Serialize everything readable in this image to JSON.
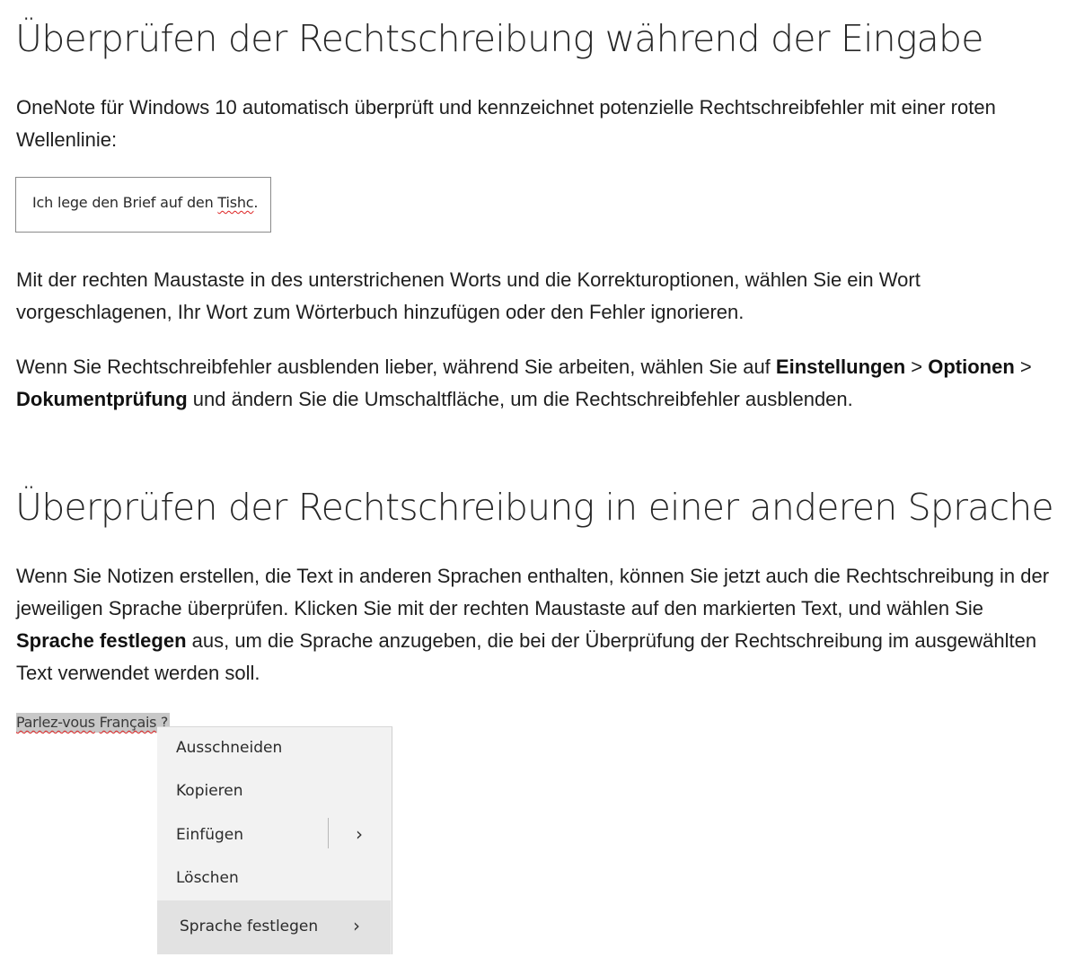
{
  "section1": {
    "heading": "Überprüfen der Rechtschreibung während der Eingabe",
    "intro": "OneNote für Windows 10 automatisch überprüft und kennzeichnet potenzielle Rechtschreibfehler mit einer roten Wellenlinie:",
    "sample": {
      "text_before": "Ich lege den Brief auf den ",
      "misspelled": "Tishc",
      "text_after": "."
    },
    "para2": "Mit der rechten Maustaste in des unterstrichenen Worts und die Korrekturoptionen, wählen Sie ein Wort vorgeschlagenen, Ihr Wort zum Wörterbuch hinzufügen oder den Fehler ignorieren.",
    "para3": {
      "part1": "Wenn Sie Rechtschreibfehler ausblenden lieber, während Sie arbeiten, wählen Sie auf ",
      "bold1": "Einstellungen",
      "sep1": " > ",
      "bold2": "Optionen",
      "sep2": " > ",
      "bold3": "Dokumentprüfung",
      "part2": " und ändern Sie die Umschaltfläche, um die Rechtschreibfehler ausblenden."
    }
  },
  "section2": {
    "heading": "Überprüfen der Rechtschreibung in einer anderen Sprache",
    "para": {
      "part1": "Wenn Sie Notizen erstellen, die Text in anderen Sprachen enthalten, können Sie jetzt auch die Rechtschreibung in der jeweiligen Sprache überprüfen. Klicken Sie mit der rechten Maustaste auf den markierten Text, und wählen Sie ",
      "bold": "Sprache festlegen",
      "part2": " aus, um die Sprache anzugeben, die bei der Überprüfung der Rechtschreibung im ausgewählten Text verwendet werden soll."
    },
    "selected_text": {
      "word1": "Parlez-vous",
      "space": " ",
      "word2": "Français",
      "tail": " ?"
    },
    "context_menu": {
      "items": [
        {
          "label": "Ausschneiden"
        },
        {
          "label": "Kopieren"
        },
        {
          "label": "Einfügen",
          "submenu_icon": "chevron-right-icon"
        },
        {
          "label": "Löschen"
        },
        {
          "label": "Sprache festlegen",
          "submenu_icon": "chevron-right-icon"
        }
      ],
      "chevron": "›"
    }
  },
  "colors": {
    "spelling_error": "#d22222",
    "selection": "#c8c8c8",
    "menu_bg": "#f2f2f2",
    "menu_highlight": "#e2e2e2"
  }
}
